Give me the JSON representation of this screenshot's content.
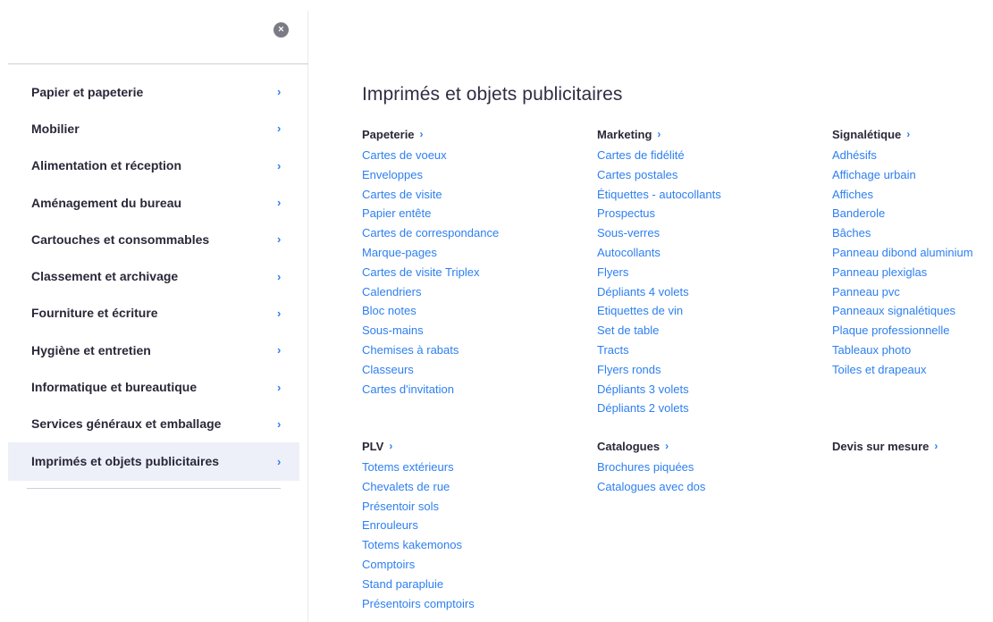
{
  "sidebar": {
    "close_icon": "×",
    "items": [
      {
        "label": "Papier et papeterie"
      },
      {
        "label": "Mobilier"
      },
      {
        "label": "Alimentation et réception"
      },
      {
        "label": "Aménagement du bureau"
      },
      {
        "label": "Cartouches et consommables"
      },
      {
        "label": "Classement et archivage"
      },
      {
        "label": "Fourniture et écriture"
      },
      {
        "label": "Hygiène et entretien"
      },
      {
        "label": "Informatique et bureautique"
      },
      {
        "label": "Services généraux et emballage"
      },
      {
        "label": "Imprimés et objets publicitaires"
      }
    ],
    "chevron": "›"
  },
  "main": {
    "title": "Imprimés et objets publicitaires",
    "chevron": "›",
    "sections": {
      "papeterie": {
        "title": "Papeterie",
        "links": [
          "Cartes de voeux",
          "Enveloppes",
          "Cartes de visite",
          "Papier entête",
          "Cartes de correspondance",
          "Marque-pages",
          "Cartes de visite Triplex",
          "Calendriers",
          "Bloc notes",
          "Sous-mains",
          "Chemises à rabats",
          "Classeurs",
          "Cartes d'invitation"
        ]
      },
      "marketing": {
        "title": "Marketing",
        "links": [
          "Cartes de fidélité",
          "Cartes postales",
          "Étiquettes - autocollants",
          "Prospectus",
          "Sous-verres",
          "Autocollants",
          "Flyers",
          "Dépliants 4 volets",
          "Etiquettes de vin",
          "Set de table",
          "Tracts",
          "Flyers ronds",
          "Dépliants 3 volets",
          "Dépliants 2 volets"
        ]
      },
      "signaletique": {
        "title": "Signalétique",
        "links": [
          "Adhésifs",
          "Affichage urbain",
          "Affiches",
          "Banderole",
          "Bâches",
          "Panneau dibond aluminium",
          "Panneau plexiglas",
          "Panneau pvc",
          "Panneaux signalétiques",
          "Plaque professionnelle",
          "Tableaux photo",
          "Toiles et drapeaux"
        ]
      },
      "plv": {
        "title": "PLV",
        "links": [
          "Totems extérieurs",
          "Chevalets de rue",
          "Présentoir sols",
          "Enrouleurs",
          "Totems kakemonos",
          "Comptoirs",
          "Stand parapluie",
          "Présentoirs comptoirs"
        ]
      },
      "catalogues": {
        "title": "Catalogues",
        "links": [
          "Brochures piquées",
          "Catalogues avec dos"
        ]
      },
      "devis": {
        "title": "Devis sur mesure",
        "links": []
      }
    }
  },
  "colors": {
    "accent": "#2d7ff0",
    "text": "#2a2839",
    "active_bg": "#edf0f8"
  }
}
